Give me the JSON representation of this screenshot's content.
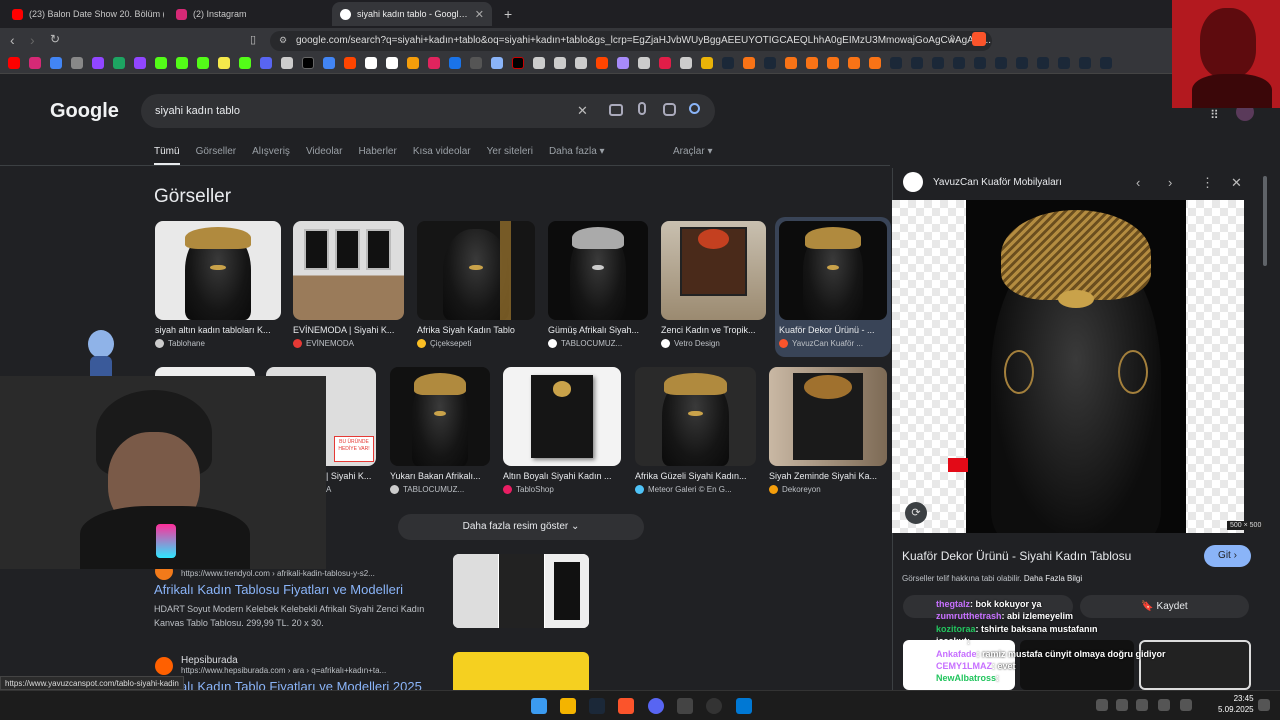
{
  "tabs": [
    {
      "label": "(23) Balon Date Show 20. Bölüm ( AT",
      "color": "#ff0000"
    },
    {
      "label": "(2) Instagram",
      "color": "#d62976"
    },
    {
      "label": "siyahi kadın tablo - Google'da Ara",
      "color": "#4285f4"
    }
  ],
  "new_tab": "+",
  "address": {
    "url": "google.com/search?q=siyahi+kadın+tablo&oq=siyahi+kadın+tablo&gs_lcrp=EgZjaHJvbWUyBggAEEUYOTIGCAEQLhhA0gEIMzU3MmowajGoAgCwAgA&s..."
  },
  "google": {
    "logo": "Google",
    "query": "siyahi kadın tablo",
    "clear": "✕",
    "filters": [
      "Tümü",
      "Görseller",
      "Alışveriş",
      "Videolar",
      "Haberler",
      "Kısa videolar",
      "Yer siteleri",
      "Daha fazla ▾"
    ],
    "tools": "Araçlar ▾",
    "images_heading": "Görseller",
    "more_images": "Daha fazla resim göster  ⌄"
  },
  "image_row1": [
    {
      "title": "siyah altın kadın tabloları K...",
      "source": "Tablohane"
    },
    {
      "title": "EVİNEMODA | Siyahi K...",
      "source": "EVİNEMODA"
    },
    {
      "title": "Afrika Siyah Kadın Tablo",
      "source": "Çiçeksepeti"
    },
    {
      "title": "Gümüş Afrikalı Siyah...",
      "source": "TABLOCUMUZ..."
    },
    {
      "title": "Zenci Kadın ve Tropik...",
      "source": "Vetro Design"
    },
    {
      "title": "Kuaför Dekor Ürünü - ...",
      "source": "YavuzCan Kuaför ..."
    }
  ],
  "image_row2": [
    {
      "title": "| Siyahi K...",
      "source": "A"
    },
    {
      "title": "Yukarı Bakan Afrikalı...",
      "source": "TABLOCUMUZ..."
    },
    {
      "title": "Altın Boyalı Siyahi Kadın ...",
      "source": "TabloShop"
    },
    {
      "title": "Afrika Güzeli Siyahi Kadın...",
      "source": "Meteor Galeri © En G..."
    },
    {
      "title": "Siyah Zeminde Siyahi Ka...",
      "source": "Dekoreyon"
    }
  ],
  "row2_badge": "BU ÜRÜNDE HEDİYE VAR!",
  "results": [
    {
      "site": "",
      "url": "https://www.trendyol.com › afrikali-kadin-tablosu-y-s2...",
      "title": "Afrikalı Kadın Tablosu Fiyatları ve Modelleri",
      "desc": "HDART Soyut Modern Kelebek Kelebekli Afrikalı Siyahi Zenci Kadın Kanvas Tablo Tablosu. 299,99 TL. 20 x 30."
    },
    {
      "site": "Hepsiburada",
      "url": "https://www.hepsiburada.com › ara › q=afrikalı+kadın+ta...",
      "title": "Afrikalı Kadın Tablo Fiyatları ve Modelleri 2025"
    }
  ],
  "panel": {
    "source": "YavuzCan Kuaför Mobilyaları",
    "dims": "500 × 500",
    "title": "Kuaför Dekor Ürünü - Siyahi Kadın Tablosu",
    "visit": "Git ›",
    "copyright": "Görseller telif hakkına tabi olabilir.",
    "learn_more": "Daha Fazla Bilgi",
    "save": "🔖 Kaydet"
  },
  "chat": [
    {
      "name": "thegtalz",
      "msg": ": bok kokuyor ya"
    },
    {
      "name": "zumrutthetrash",
      "msg": ": abi izlemeyelim"
    },
    {
      "name": "kozitoraa",
      "msg": ": tshirte baksana mustafanın"
    },
    {
      "name": "iceekut",
      "msg": ":"
    },
    {
      "name": "Ankafade",
      "msg": ": ramiz mustafa cünyit  olmaya doğru gidiyor"
    },
    {
      "name": "CEMY1LMAZ",
      "msg": ": evet"
    },
    {
      "name": "NewAlbatross",
      "msg": ":"
    }
  ],
  "status_url": "https://www.yavuzcanspot.com/tablo-siyahi-kadin",
  "clock": {
    "time": "23:45",
    "date": "5.09.2025"
  },
  "colors": {
    "link": "#8ab4f8",
    "bg": "#202124",
    "accent": "#8ab4f8"
  }
}
